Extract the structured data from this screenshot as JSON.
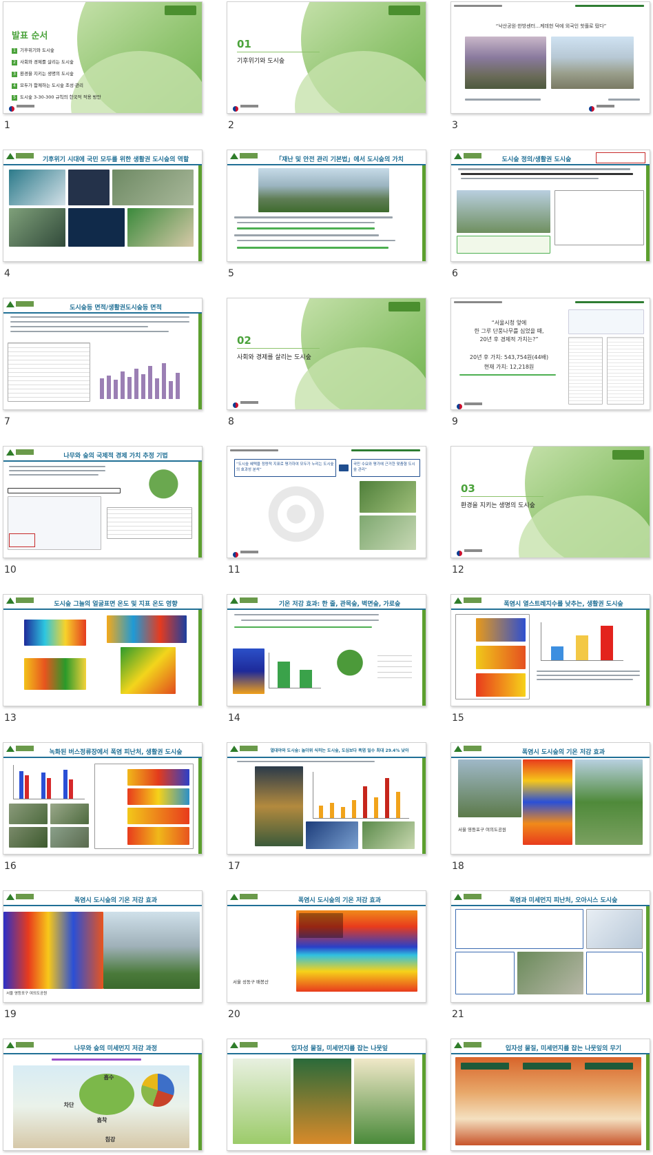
{
  "slides": [
    {
      "n": "1",
      "kind": "agenda",
      "title": "발표 순서",
      "items": [
        "기후위기와 도시숲",
        "사회와 경제를 살리는 도시숲",
        "환경을 지키는 생명의 도시숲",
        "모두가 함께하는 도시숲 조성·관리",
        "도시숲 3-30-300 규칙의 한국적 적용 방안"
      ]
    },
    {
      "n": "2",
      "kind": "section",
      "num": "01",
      "title": "기후위기와 도시숲"
    },
    {
      "n": "3",
      "kind": "photo",
      "title": "“낙산공원·한방센터…케데헌 덕에 외국인 핫플로 떴다”"
    },
    {
      "n": "4",
      "kind": "content",
      "title": "기후위기 시대에 국민 모두를 위한 생활권 도시숲의 역할"
    },
    {
      "n": "5",
      "kind": "content",
      "title": "「재난 및 안전 관리 기본법」에서 도시숲의 가치"
    },
    {
      "n": "6",
      "kind": "content",
      "title": "도시숲 정의/생활권 도시숲"
    },
    {
      "n": "7",
      "kind": "content",
      "title": "도시숲등 면적/생활권도시숲등 면적"
    },
    {
      "n": "8",
      "kind": "section",
      "num": "02",
      "title": "사회와 경제를 살리는 도시숲"
    },
    {
      "n": "9",
      "kind": "quote",
      "quote": [
        "“서울시청 앞에",
        "한 그루 단풍나무를 심었을 때,",
        "20년 후 경제적 가치는?”"
      ],
      "line1": "20년 후 가치: 543,754원(44배)",
      "line2": "현재 가치: 12,218원"
    },
    {
      "n": "10",
      "kind": "content",
      "title": "나무와 숲의 국제적 경제 가치 추정 기법"
    },
    {
      "n": "11",
      "kind": "radar",
      "box1": "“도시숲 혜택을 정량적 지표로 평가하여 모두가 누리는 도시숲의 효과성 분석”",
      "box2": "국민 수요와 평가에 근거한 맞춤형 도시숲 관리”"
    },
    {
      "n": "12",
      "kind": "section",
      "num": "03",
      "title": "환경을 지키는 생명의 도시숲"
    },
    {
      "n": "13",
      "kind": "content",
      "title": "도시숲 그늘의 얼굴표면 온도 및 지표 온도 영향"
    },
    {
      "n": "14",
      "kind": "content",
      "title": "기온 저감 효과: 한 줄, 관목숲, 벽면숲, 가로숲"
    },
    {
      "n": "15",
      "kind": "content",
      "title": "폭염시 열스트레지수를 낮추는, 생활권 도시숲"
    },
    {
      "n": "16",
      "kind": "content",
      "title": "녹화된 버스정류장에서 폭염 피난처, 생활권 도시숲"
    },
    {
      "n": "17",
      "kind": "content",
      "title": "열대야와 도시숲: 놀더위 식히는 도시숲, 도심보다 폭염 일수 최대 29.4% 낮아"
    },
    {
      "n": "18",
      "kind": "thermal",
      "title": "폭염시 도시숲의 기온 저감 효과",
      "caption": "서울 영등포구 여의도공원"
    },
    {
      "n": "19",
      "kind": "thermal",
      "title": "폭염시 도시숲의 기온 저감 효과",
      "caption": "서울 영등포구 여의도공원"
    },
    {
      "n": "20",
      "kind": "thermal",
      "title": "폭염시 도시숲의 기온 저감 효과",
      "caption": "서울 성동구 배봉산"
    },
    {
      "n": "21",
      "kind": "content",
      "title": "폭염과 미세먼지 피난처, 오아시스 도시숲"
    },
    {
      "n": "22",
      "kind": "content",
      "title": "나무와 숲의 미세먼지 저감 과정",
      "labels": [
        "흡수",
        "차단",
        "흡착",
        "침강"
      ]
    },
    {
      "n": "23",
      "kind": "content",
      "title": "입자성 물질, 미세먼지를 잡는 나뭇잎"
    },
    {
      "n": "24",
      "kind": "content",
      "title": "입자성 물질, 미세먼지를 잡는 나뭇잎의 무기"
    }
  ]
}
